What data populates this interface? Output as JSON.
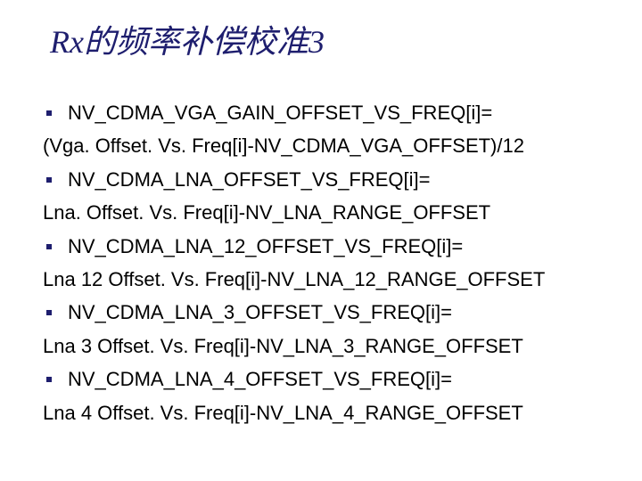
{
  "title": "Rx的频率补偿校准3",
  "items": [
    {
      "head": "NV_CDMA_VGA_GAIN_OFFSET_VS_FREQ[i]=",
      "wrap": "(Vga. Offset. Vs. Freq[i]-NV_CDMA_VGA_OFFSET)/12"
    },
    {
      "head": "NV_CDMA_LNA_OFFSET_VS_FREQ[i]=",
      "wrap": "Lna. Offset. Vs. Freq[i]-NV_LNA_RANGE_OFFSET"
    },
    {
      "head": "NV_CDMA_LNA_12_OFFSET_VS_FREQ[i]=",
      "wrap": "Lna 12 Offset. Vs. Freq[i]-NV_LNA_12_RANGE_OFFSET"
    },
    {
      "head": "NV_CDMA_LNA_3_OFFSET_VS_FREQ[i]=",
      "wrap": "Lna 3 Offset. Vs. Freq[i]-NV_LNA_3_RANGE_OFFSET"
    },
    {
      "head": "NV_CDMA_LNA_4_OFFSET_VS_FREQ[i]=",
      "wrap": "Lna 4 Offset. Vs. Freq[i]-NV_LNA_4_RANGE_OFFSET"
    }
  ]
}
